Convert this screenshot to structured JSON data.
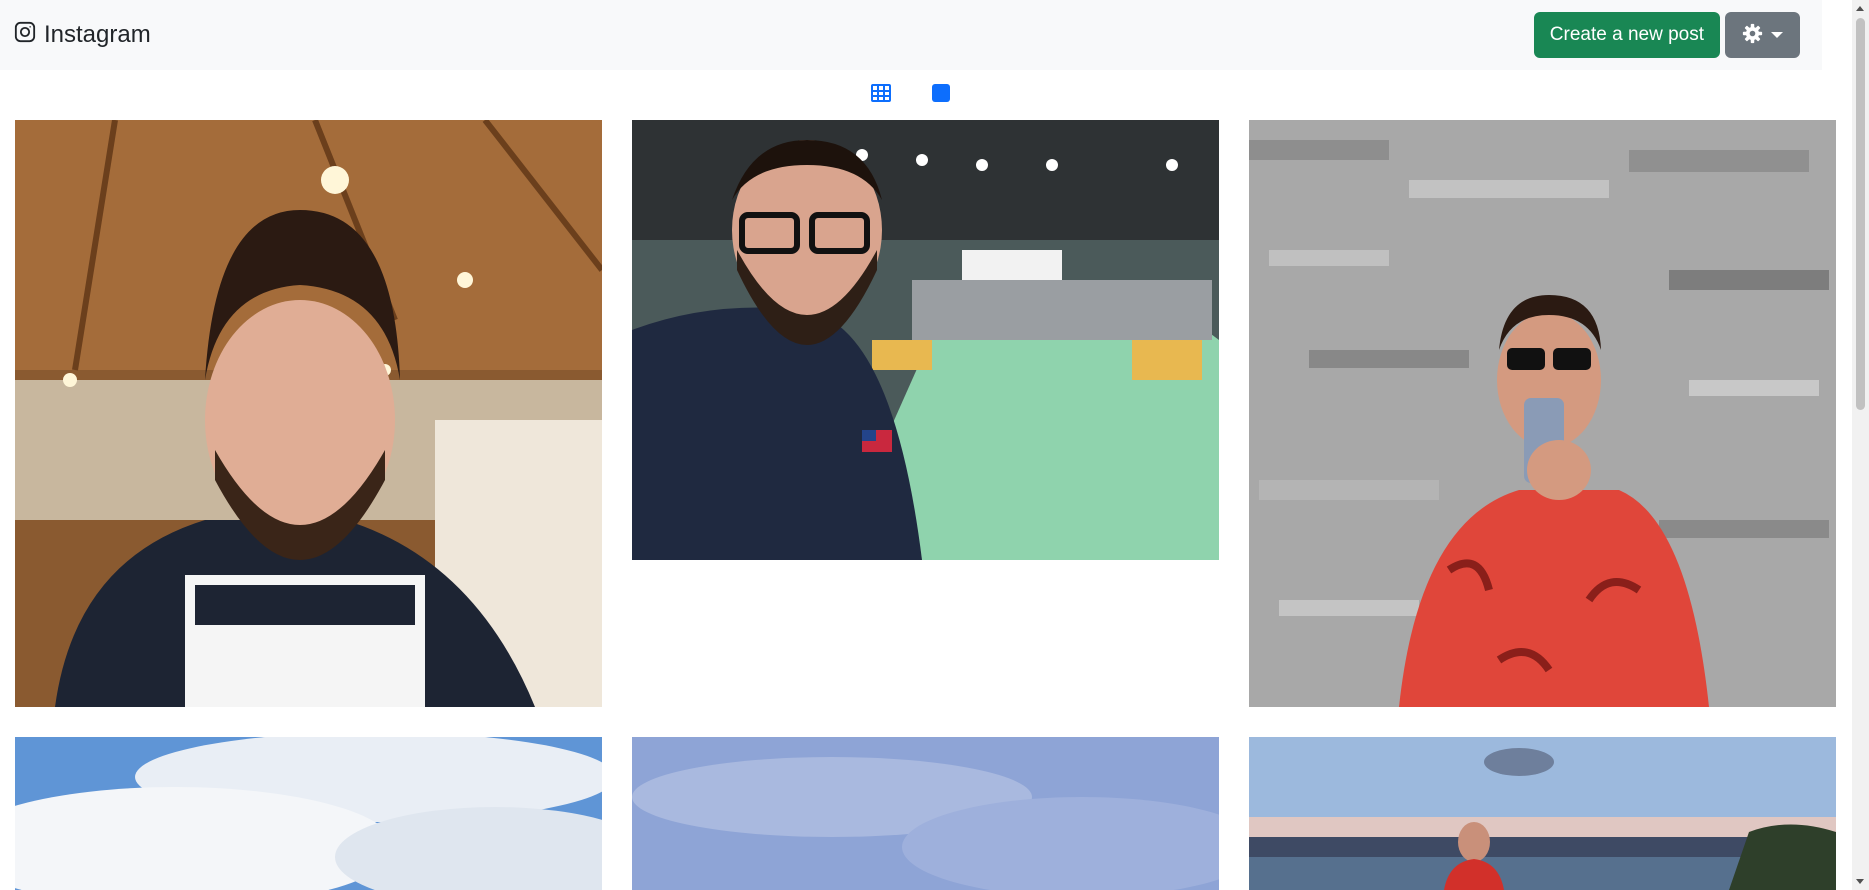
{
  "navbar": {
    "brand_icon": "instagram-icon",
    "brand_label": "Instagram",
    "create_button_label": "Create a new post",
    "settings_icon": "gear-icon"
  },
  "view_toggle": {
    "grid_icon": "grid-icon",
    "single_icon": "square-icon",
    "active_color": "#0d6efd"
  },
  "colors": {
    "navbar_bg": "#f8f9fa",
    "create_button": "#198754",
    "settings_button": "#6c757d"
  },
  "posts": [
    {
      "name": "post-photo-restaurant-selfie"
    },
    {
      "name": "post-photo-hall-selfie"
    },
    {
      "name": "post-photo-mirror-selfie"
    },
    {
      "name": "post-photo-clouds"
    },
    {
      "name": "post-photo-sky"
    },
    {
      "name": "post-photo-waterfront"
    }
  ]
}
